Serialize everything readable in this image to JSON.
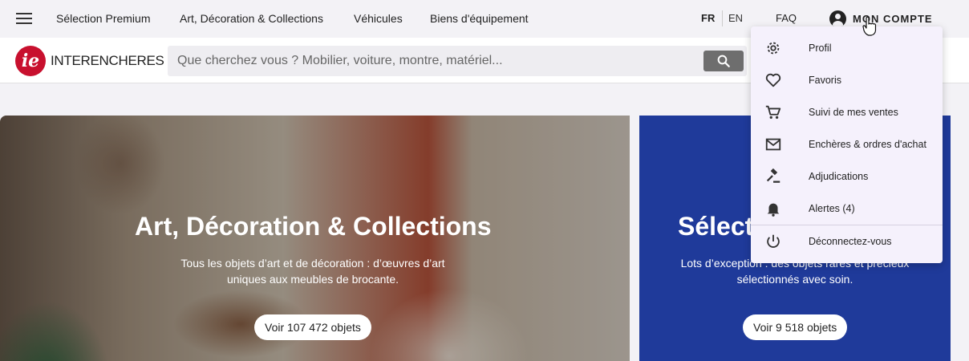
{
  "topnav": {
    "menu_icon": "hamburger-menu-icon",
    "links": [
      "Sélection Premium",
      "Art, Décoration & Collections",
      "Véhicules",
      "Biens d'équipement"
    ],
    "lang_fr": "FR",
    "lang_en": "EN",
    "faq": "FAQ",
    "account_label": "MON COMPTE",
    "account_icon": "account-circle-icon"
  },
  "header": {
    "logo_mark": "ie",
    "logo_text": "INTERENCHERES",
    "search_placeholder": "Que cherchez vous ? Mobilier, voiture, montre, matériel...",
    "search_icon": "search-icon"
  },
  "cards": {
    "art": {
      "title": "Art, Décoration & Collections",
      "desc_line1": "Tous les objets d’art et de décoration : d’œuvres d’art",
      "desc_line2": "uniques aux meubles de brocante.",
      "button": "Voir 107 472 objets"
    },
    "premium": {
      "title": "Sélection Premium",
      "desc_line1": "Lots d’exception : des objets rares et précieux",
      "desc_line2": "sélectionnés avec soin.",
      "button": "Voir 9 518 objets",
      "color": "#1f3a9a"
    }
  },
  "account_menu": {
    "items": [
      {
        "label": "Profil",
        "icon": "gear-icon"
      },
      {
        "label": "Favoris",
        "icon": "heart-icon"
      },
      {
        "label": "Suivi de mes ventes",
        "icon": "cart-icon"
      },
      {
        "label": "Enchères & ordres d'achat",
        "icon": "mail-icon"
      },
      {
        "label": "Adjudications",
        "icon": "gavel-icon"
      },
      {
        "label": "Alertes (4)",
        "icon": "bell-icon"
      },
      {
        "label": "Déconnectez-vous",
        "icon": "power-icon"
      }
    ]
  },
  "colors": {
    "brand_red": "#c8102e",
    "premium_blue": "#1f3a9a",
    "dropdown_bg": "#f5f1fc"
  }
}
